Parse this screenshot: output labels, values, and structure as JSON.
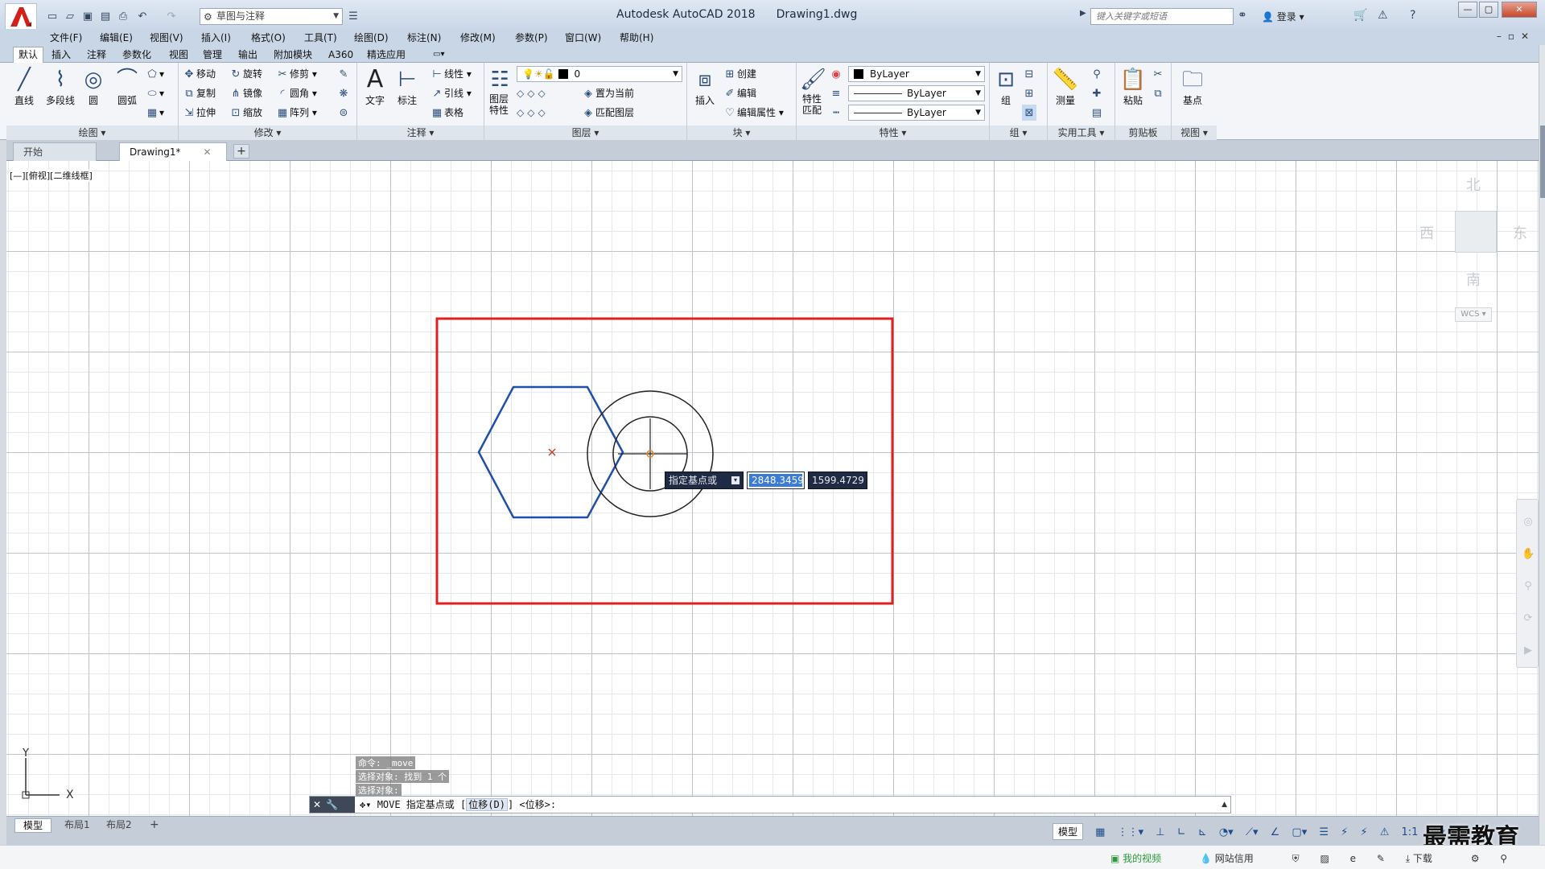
{
  "titlebar": {
    "app_title": "Autodesk AutoCAD 2018",
    "doc_title": "Drawing1.dwg",
    "workspace": "草图与注释",
    "search_placeholder": "键入关键字或短语",
    "login_label": "登录",
    "qat_icons": [
      "new-icon",
      "open-icon",
      "save-icon",
      "save-as-icon",
      "print-icon",
      "undo-icon",
      "redo-icon"
    ]
  },
  "menubar": {
    "items": [
      "文件(F)",
      "编辑(E)",
      "视图(V)",
      "插入(I)",
      "格式(O)",
      "工具(T)",
      "绘图(D)",
      "标注(N)",
      "修改(M)",
      "参数(P)",
      "窗口(W)",
      "帮助(H)"
    ]
  },
  "ribbon_tabs": {
    "items": [
      "默认",
      "插入",
      "注释",
      "参数化",
      "视图",
      "管理",
      "输出",
      "附加模块",
      "A360",
      "精选应用"
    ],
    "active": "默认"
  },
  "panels": {
    "draw": {
      "title": "绘图 ▾",
      "line": "直线",
      "polyline": "多段线",
      "circle": "圆",
      "arc": "圆弧"
    },
    "modify": {
      "title": "修改 ▾",
      "move": "移动",
      "rotate": "旋转",
      "trim": "修剪",
      "copy": "复制",
      "mirror": "镜像",
      "fillet": "圆角",
      "stretch": "拉伸",
      "scale": "缩放",
      "array": "阵列"
    },
    "annotation": {
      "title": "注释 ▾",
      "text": "文字",
      "dimension": "标注",
      "linear": "线性",
      "leader": "引线",
      "table": "表格"
    },
    "layers": {
      "title": "图层 ▾",
      "props": "图层特性",
      "current_layer": "0",
      "set_current": "置为当前",
      "match_layer": "匹配图层"
    },
    "block": {
      "title": "块 ▾",
      "insert": "插入",
      "create": "创建",
      "edit": "编辑",
      "edit_attr": "编辑属性"
    },
    "properties": {
      "title": "特性 ▾",
      "match": "特性匹配",
      "color": "ByLayer",
      "linetype": "ByLayer",
      "lineweight": "ByLayer"
    },
    "groups": {
      "title": "组 ▾",
      "group": "组"
    },
    "utilities": {
      "title": "实用工具 ▾",
      "measure": "测量"
    },
    "clipboard": {
      "title": "剪贴板",
      "paste": "粘贴"
    },
    "view": {
      "title": "视图 ▾",
      "base": "基点"
    }
  },
  "file_tabs": {
    "start": "开始",
    "drawing": "Drawing1*"
  },
  "viewport": {
    "label": "[—][俯视][二维线框]"
  },
  "viewcube": {
    "north": "北",
    "south": "南",
    "east": "东",
    "west": "西",
    "wcs": "WCS"
  },
  "dynamic_input": {
    "prompt": "指定基点或",
    "x": "2848.3459",
    "y": "1599.4729"
  },
  "ucs": {
    "x": "X",
    "y": "Y"
  },
  "command_history": [
    "命令: _move",
    "选择对象: 找到 1 个",
    "选择对象:"
  ],
  "command_line": {
    "cmd": "MOVE 指定基点或 [",
    "option": "位移(D)",
    "rest": "] <位移>:"
  },
  "layout_tabs": [
    "模型",
    "布局1",
    "布局2"
  ],
  "statusbar": {
    "model": "模型",
    "scale": "1:1"
  },
  "watermark": "最需教育",
  "os_strip": {
    "video": "我的视频",
    "credit": "网站信用",
    "download": "下载"
  },
  "colors": {
    "selection_rect": "#e02020",
    "hexagon": "#1f4fa8",
    "accent": "#3b7bd8"
  }
}
